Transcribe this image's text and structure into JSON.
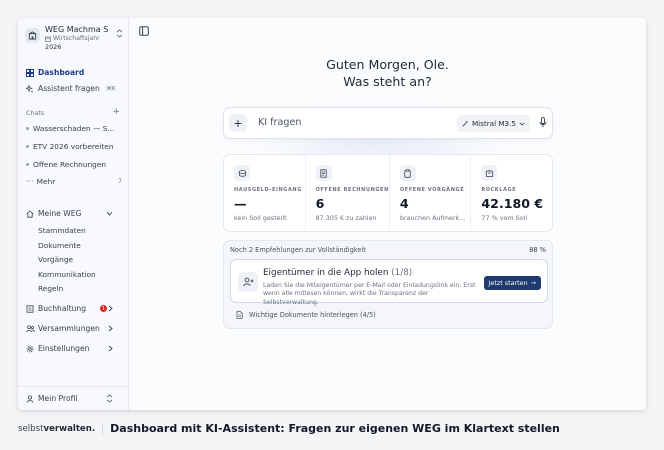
{
  "org": {
    "name": "WEG Machma S...",
    "sub_label": "Wirtschaftsjahr",
    "year": "2026"
  },
  "nav": {
    "dashboard": "Dashboard",
    "assistant": "Assistent fragen",
    "assistant_shortcut": "⌘K"
  },
  "chats": {
    "label": "Chats",
    "items": [
      "Wasserschaden — S...",
      "ETV 2026 vorbereiten",
      "Offene Rechnungen"
    ],
    "more": "Mehr",
    "more_count": "7"
  },
  "sections": {
    "meine_weg": "Meine WEG",
    "meine_weg_items": [
      "Stammdaten",
      "Dokumente",
      "Vorgänge",
      "Kommunikation",
      "Regeln"
    ],
    "buchhaltung": "Buchhaltung",
    "buchhaltung_badge": "1",
    "versammlungen": "Versammlungen",
    "einstellungen": "Einstellungen",
    "profil": "Mein Profil"
  },
  "main": {
    "greeting_line1": "Guten Morgen, Ole.",
    "greeting_line2": "Was steht an?",
    "ask_placeholder": "KI fragen",
    "model": "Mistral M3.5"
  },
  "stats": [
    {
      "label": "HAUSGELD-EINGANG",
      "value": "—",
      "sub": "kein Soll gestellt",
      "icon": "coins-icon"
    },
    {
      "label": "OFFENE RECHNUNGEN",
      "value": "6",
      "sub": "87.305 € zu zahlen",
      "icon": "invoice-icon"
    },
    {
      "label": "OFFENE VORGÄNGE",
      "value": "4",
      "sub": "brauchen Aufmerk...",
      "icon": "clipboard-icon"
    },
    {
      "label": "RÜCKLAGE",
      "value": "42.180 €",
      "sub": "77 % vom Soll",
      "icon": "piggy-bank-icon"
    }
  ],
  "recommendations": {
    "header": "Noch 2 Empfehlungen zur Vollständigkeit",
    "percent": "88 %",
    "card_title": "Eigentümer in die App holen",
    "card_count": "(1/8)",
    "card_desc": "Laden Sie die Miteigentümer per E-Mail oder Einladungslink ein. Erst wenn alle mitlesen können, wirkt die Transparenz der Selbstverwaltung.",
    "button": "Jetzt starten",
    "next_item": "Wichtige Dokumente hinterlegen (4/5)"
  },
  "caption": {
    "brand_prefix": "selbst",
    "brand_bold": "verwalten.",
    "text": "Dashboard mit KI-Assistent: Fragen zur eigenen WEG im Klartext stellen"
  },
  "colors": {
    "accent": "#1e3a8a",
    "button": "#1e3a6e",
    "badge": "#dc2626"
  }
}
